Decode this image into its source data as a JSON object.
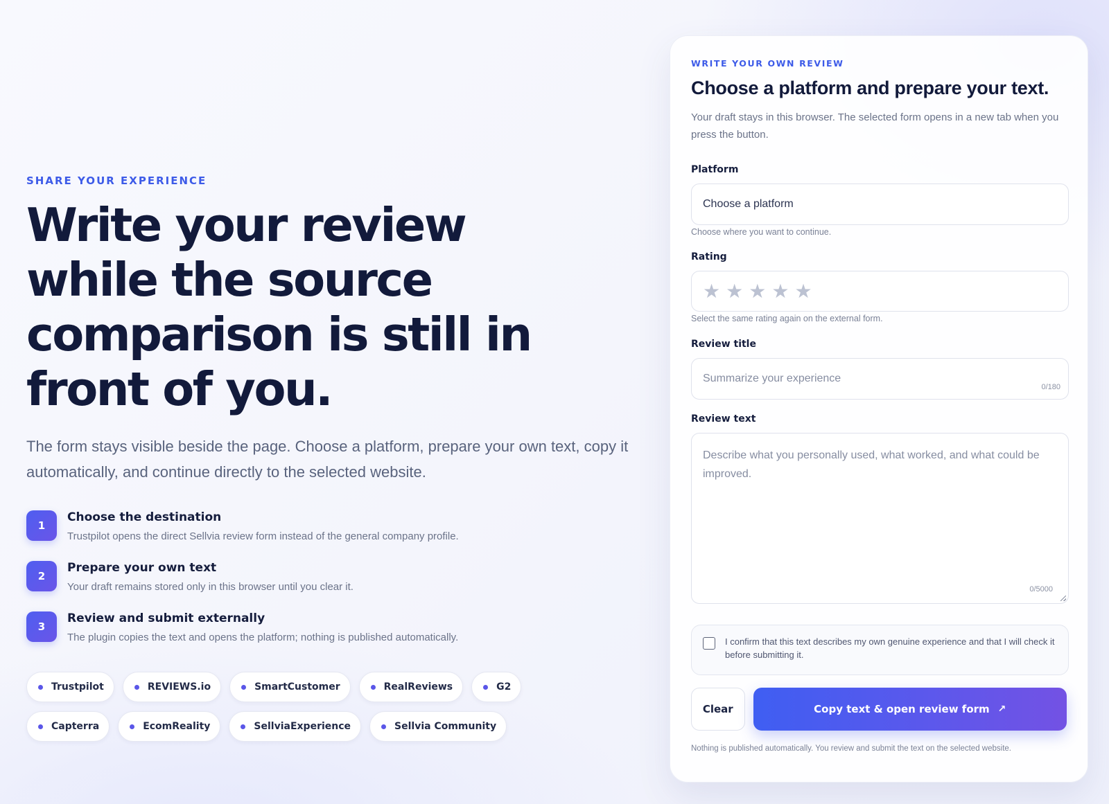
{
  "hero": {
    "eyebrow": "SHARE YOUR EXPERIENCE",
    "title": "Write your review while the source comparison is still in front of you.",
    "subtitle": "The form stays visible beside the page. Choose a platform, prepare your own text, copy it automatically, and continue directly to the selected website."
  },
  "steps": [
    {
      "number": "1",
      "title": "Choose the destination",
      "description": "Trustpilot opens the direct Sellvia review form instead of the general company profile."
    },
    {
      "number": "2",
      "title": "Prepare your own text",
      "description": "Your draft remains stored only in this browser until you clear it."
    },
    {
      "number": "3",
      "title": "Review and submit externally",
      "description": "The plugin copies the text and opens the platform; nothing is published automatically."
    }
  ],
  "platform_chips": [
    "Trustpilot",
    "REVIEWS.io",
    "SmartCustomer",
    "RealReviews",
    "G2",
    "Capterra",
    "EcomReality",
    "SellviaExperience",
    "Sellvia Community"
  ],
  "form": {
    "eyebrow": "WRITE YOUR OWN REVIEW",
    "title": "Choose a platform and prepare your text.",
    "subtitle": "Your draft stays in this browser. The selected form opens in a new tab when you press the button.",
    "platform": {
      "label": "Platform",
      "value": "Choose a platform",
      "hint": "Choose where you want to continue."
    },
    "rating": {
      "label": "Rating",
      "value": 0,
      "max": 5,
      "star_symbol": "★",
      "hint": "Select the same rating again on the external form."
    },
    "review_title": {
      "label": "Review title",
      "placeholder": "Summarize your experience",
      "counter": "0/180"
    },
    "review_text": {
      "label": "Review text",
      "placeholder": "Describe what you personally used, what worked, and what could be improved.",
      "counter": "0/5000"
    },
    "confirm": {
      "checked": false,
      "text": "I confirm that this text describes my own genuine experience and that I will check it before submitting it."
    },
    "clear_label": "Clear",
    "submit_label": "Copy text & open review form",
    "submit_icon": "↗",
    "footnote": "Nothing is published automatically. You review and submit the text on the selected website."
  },
  "colors": {
    "accent": "#3d5be8",
    "button_gradient_start": "#3f5ef2",
    "button_gradient_end": "#7352e4",
    "star_inactive": "#bcc2d2"
  }
}
